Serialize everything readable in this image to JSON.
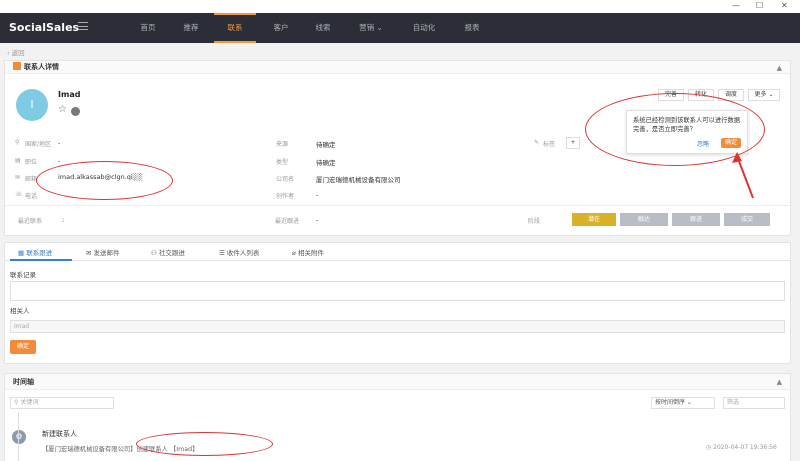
{
  "window": {
    "minimize": "—",
    "maximize": "☐",
    "close": "✕"
  },
  "app": {
    "logo": "SocialSales"
  },
  "nav": [
    {
      "label": "首页"
    },
    {
      "label": "推荐"
    },
    {
      "label": "联系"
    },
    {
      "label": "客户"
    },
    {
      "label": "线索"
    },
    {
      "label": "营销 ⌄"
    },
    {
      "label": "自动化"
    },
    {
      "label": "报表"
    }
  ],
  "nav_active_index": 2,
  "back_link": "‹ 返回",
  "contact_panel": {
    "title": "联系人详情",
    "collapse": "▲"
  },
  "contact": {
    "avatar_letter": "I",
    "name": "Imad",
    "star": "☆"
  },
  "actions": {
    "complete": "完善",
    "convert": "转化",
    "assign": "调度",
    "more": "更多 ⌄"
  },
  "popup": {
    "message": "系统已经检测到该联系人可以进行数据完善，是否立即完善？",
    "cancel": "忽略",
    "confirm": "确定"
  },
  "fields_left": [
    {
      "icon": "location-icon",
      "label": "国家/地区",
      "value": "-"
    },
    {
      "icon": "briefcase-icon",
      "label": "职位",
      "value": "-"
    },
    {
      "icon": "mail-icon",
      "label": "邮箱",
      "value": "imad.alkassab@clgn.qi░░"
    },
    {
      "icon": "phone-icon",
      "label": "电话",
      "value": "-"
    }
  ],
  "fields_mid": [
    {
      "label": "来源",
      "value": "待确定"
    },
    {
      "label": "类型",
      "value": "待确定"
    },
    {
      "label": "公司名",
      "value": "厦门宏瑞德机械设备有限公司"
    },
    {
      "label": "创作者",
      "value": "-"
    }
  ],
  "tag": {
    "label": "标签",
    "add": "+"
  },
  "recent": {
    "contact_label": "最近联系",
    "contact_value": ":",
    "followup_label": "最近跟进",
    "followup_value": "-"
  },
  "stage_label": "阶段",
  "stages": [
    {
      "label": "潜在"
    },
    {
      "label": "触达"
    },
    {
      "label": "跟进"
    },
    {
      "label": "成交"
    }
  ],
  "tabs": [
    {
      "icon": "calendar-icon",
      "label": "联系跟进"
    },
    {
      "icon": "envelope-icon",
      "label": "发送邮件"
    },
    {
      "icon": "users-icon",
      "label": "社交跟进"
    },
    {
      "icon": "list-icon",
      "label": "收件人列表"
    },
    {
      "icon": "paperclip-icon",
      "label": "相关附件"
    }
  ],
  "form": {
    "record_label": "联系记录",
    "related_label": "相关人",
    "related_value": "Imad",
    "submit": "确定"
  },
  "timeline": {
    "title": "时间轴",
    "collapse": "▲",
    "search_placeholder": "关键词",
    "sort": "按时间倒序 ⌄",
    "filter_placeholder": "筛选",
    "entry_title": "新建联系人",
    "entry_text": "【厦门宏瑞德机械设备有限公司】创建联系人 【Imad】",
    "entry_time": "◷ 2020-04-07 19:36:56"
  }
}
